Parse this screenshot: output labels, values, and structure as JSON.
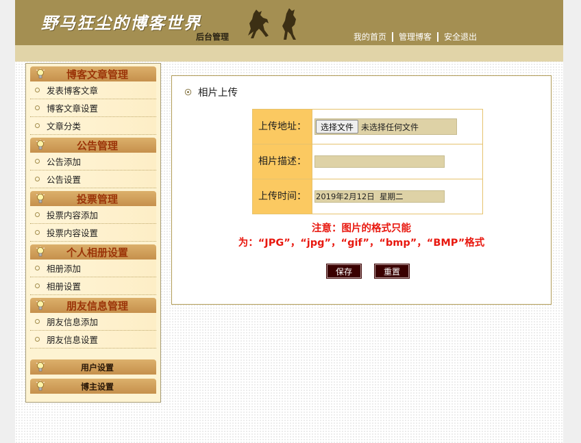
{
  "header": {
    "site_title": "野马狂尘的博客世界",
    "subtitle": "后台管理",
    "links": [
      "我的首页",
      "管理博客",
      "安全退出"
    ]
  },
  "sidebar": {
    "groups": [
      {
        "title": "博客文章管理",
        "items": [
          "发表博客文章",
          "博客文章设置",
          "文章分类"
        ]
      },
      {
        "title": "公告管理",
        "items": [
          "公告添加",
          "公告设置"
        ]
      },
      {
        "title": "投票管理",
        "items": [
          "投票内容添加",
          "投票内容设置"
        ]
      },
      {
        "title": "个人相册设置",
        "items": [
          "相册添加",
          "相册设置"
        ]
      },
      {
        "title": "朋友信息管理",
        "items": [
          "朋友信息添加",
          "朋友信息设置"
        ]
      },
      {
        "title": "用户设置",
        "items": []
      },
      {
        "title": "博主设置",
        "items": []
      }
    ]
  },
  "content": {
    "title": "相片上传",
    "form": {
      "upload_label": "上传地址：",
      "file_button": "选择文件",
      "file_status": "未选择任何文件",
      "desc_label": "相片描述：",
      "desc_value": "",
      "time_label": "上传时间：",
      "time_value": "2019年2月12日  星期二"
    },
    "notice_line1": "注意：图片的格式只能",
    "notice_line2": "为：“JPG”，“jpg”，“gif”，“bmp”，“BMP”格式",
    "save_button": "保存",
    "reset_button": "重置"
  },
  "colors": {
    "header_bg": "#a48f52",
    "subbar_bg": "#e1d4a8",
    "menu_header": "#c6904c",
    "menu_header_text": "#9b3408",
    "label_bg": "#fbc961",
    "notice_text": "#e8180f",
    "button_bg": "#3a0000"
  },
  "icons": [
    "horse-icon",
    "lightbulb-icon",
    "bullet-ring-icon",
    "gear-icon"
  ]
}
